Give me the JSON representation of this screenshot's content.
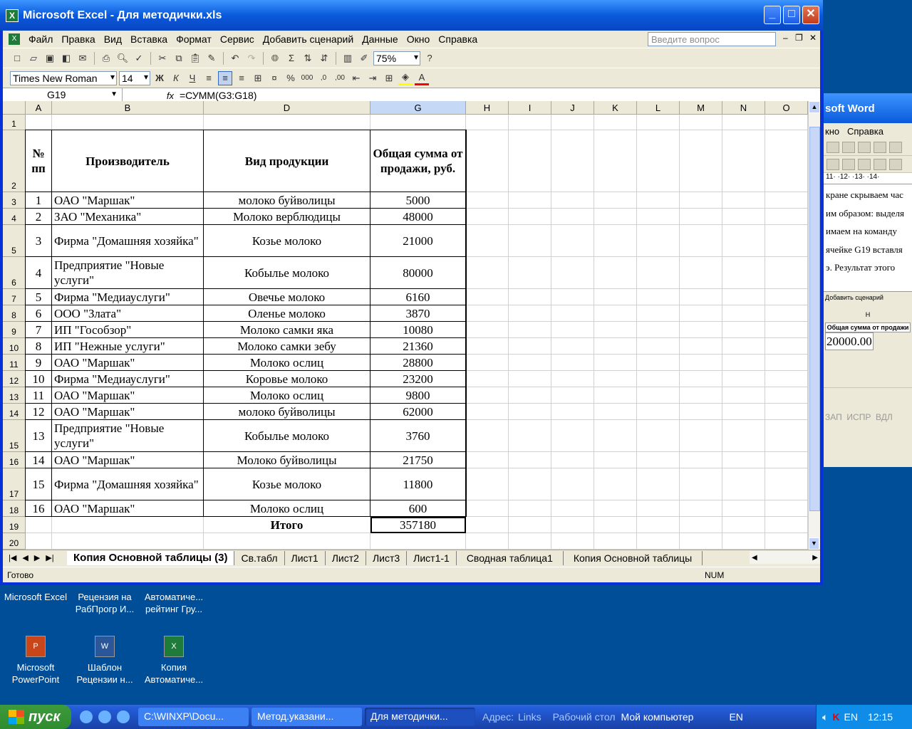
{
  "excel": {
    "title": "Microsoft Excel - Для методички.xls",
    "menu": [
      "Файл",
      "Правка",
      "Вид",
      "Вставка",
      "Формат",
      "Сервис",
      "Добавить сценарий",
      "Данные",
      "Окно",
      "Справка"
    ],
    "ask_placeholder": "Введите вопрос",
    "zoom": "75%",
    "font_name": "Times New Roman",
    "font_size": "14",
    "name_box": "G19",
    "fx": "fx",
    "formula": "=СУММ(G3:G18)",
    "columns": [
      "A",
      "B",
      "D",
      "G",
      "H",
      "I",
      "J",
      "K",
      "L",
      "M",
      "N",
      "O"
    ],
    "headers": {
      "num": "№ пп",
      "maker": "Производитель",
      "product": "Вид продукции",
      "sum": "Общая сумма от продажи, руб."
    },
    "rows": [
      {
        "r": "3",
        "n": "1",
        "maker": "ОАО \"Маршак\"",
        "product": "молоко буйволицы",
        "sum": "5000"
      },
      {
        "r": "4",
        "n": "2",
        "maker": "ЗАО \"Механика\"",
        "product": "Молоко верблюдицы",
        "sum": "48000"
      },
      {
        "r": "5",
        "n": "3",
        "maker": "Фирма \"Домашняя хозяйка\"",
        "product": "Козье молоко",
        "sum": "21000"
      },
      {
        "r": "6",
        "n": "4",
        "maker": "Предприятие \"Новые услуги\"",
        "product": "Кобылье молоко",
        "sum": "80000"
      },
      {
        "r": "7",
        "n": "5",
        "maker": "Фирма \"Медиауслуги\"",
        "product": "Овечье молоко",
        "sum": "6160"
      },
      {
        "r": "8",
        "n": "6",
        "maker": "ООО \"Злата\"",
        "product": "Оленье молоко",
        "sum": "3870"
      },
      {
        "r": "9",
        "n": "7",
        "maker": "ИП \"Гособзор\"",
        "product": "Молоко самки яка",
        "sum": "10080"
      },
      {
        "r": "10",
        "n": "8",
        "maker": "ИП \"Нежные услуги\"",
        "product": "Молоко самки зебу",
        "sum": "21360"
      },
      {
        "r": "11",
        "n": "9",
        "maker": "ОАО \"Маршак\"",
        "product": "Молоко ослиц",
        "sum": "28800"
      },
      {
        "r": "12",
        "n": "10",
        "maker": "Фирма \"Медиауслуги\"",
        "product": "Коровье молоко",
        "sum": "23200"
      },
      {
        "r": "13",
        "n": "11",
        "maker": "ОАО \"Маршак\"",
        "product": "Молоко ослиц",
        "sum": "9800"
      },
      {
        "r": "14",
        "n": "12",
        "maker": "ОАО \"Маршак\"",
        "product": "молоко буйволицы",
        "sum": "62000"
      },
      {
        "r": "15",
        "n": "13",
        "maker": "Предприятие \"Новые услуги\"",
        "product": "Кобылье молоко",
        "sum": "3760"
      },
      {
        "r": "16",
        "n": "14",
        "maker": "ОАО \"Маршак\"",
        "product": "Молоко буйволицы",
        "sum": "21750"
      },
      {
        "r": "17",
        "n": "15",
        "maker": "Фирма \"Домашняя хозяйка\"",
        "product": "Козье молоко",
        "sum": "11800"
      },
      {
        "r": "18",
        "n": "16",
        "maker": "ОАО \"Маршак\"",
        "product": "Молоко ослиц",
        "sum": "600"
      }
    ],
    "total_label": "Итого",
    "total_value": "357180",
    "sheet_tabs": [
      "Копия Основной таблицы (3)",
      "Св.табл",
      "Лист1",
      "Лист2",
      "Лист3",
      "Лист1-1",
      "Сводная таблица1",
      "Копия Основной таблицы"
    ],
    "status": "Готово",
    "status_num": "NUM"
  },
  "word": {
    "title": "soft Word",
    "menu": [
      "кно",
      "Справка"
    ],
    "ruler": "11· ·12· ·13· ·14·",
    "lines": [
      "кране скрываем час",
      "им образом: выделя",
      "имаем на команду",
      "ячейке G19 вставля",
      "э. Результат этого"
    ],
    "img_menu": "Добавить сценарий",
    "img_col": "H",
    "img_header": "Общая сумма от продажи",
    "img_value": "20000.00",
    "status": [
      "ЗАП",
      "ИСПР",
      "ВДЛ"
    ]
  },
  "desktop_icons": [
    {
      "label": "Microsoft Excel"
    },
    {
      "label": "Рецензия на РабПрогр И..."
    },
    {
      "label": "Автоматиче... рейтинг Гру..."
    },
    {
      "label": "Microsoft PowerPoint"
    },
    {
      "label": "Шаблон Рецензии н..."
    },
    {
      "label": "Копия Автоматиче..."
    }
  ],
  "taskbar": {
    "start": "пуск",
    "tasks": [
      "C:\\WINXP\\Docu...",
      "Метод.указани...",
      "Для методички..."
    ],
    "address": "Адрес:",
    "links": "Links",
    "desktop": "Рабочий стол",
    "mycomp": "Мой компьютер",
    "lang": "EN",
    "tray_lang": "EN",
    "time": "12:15"
  }
}
